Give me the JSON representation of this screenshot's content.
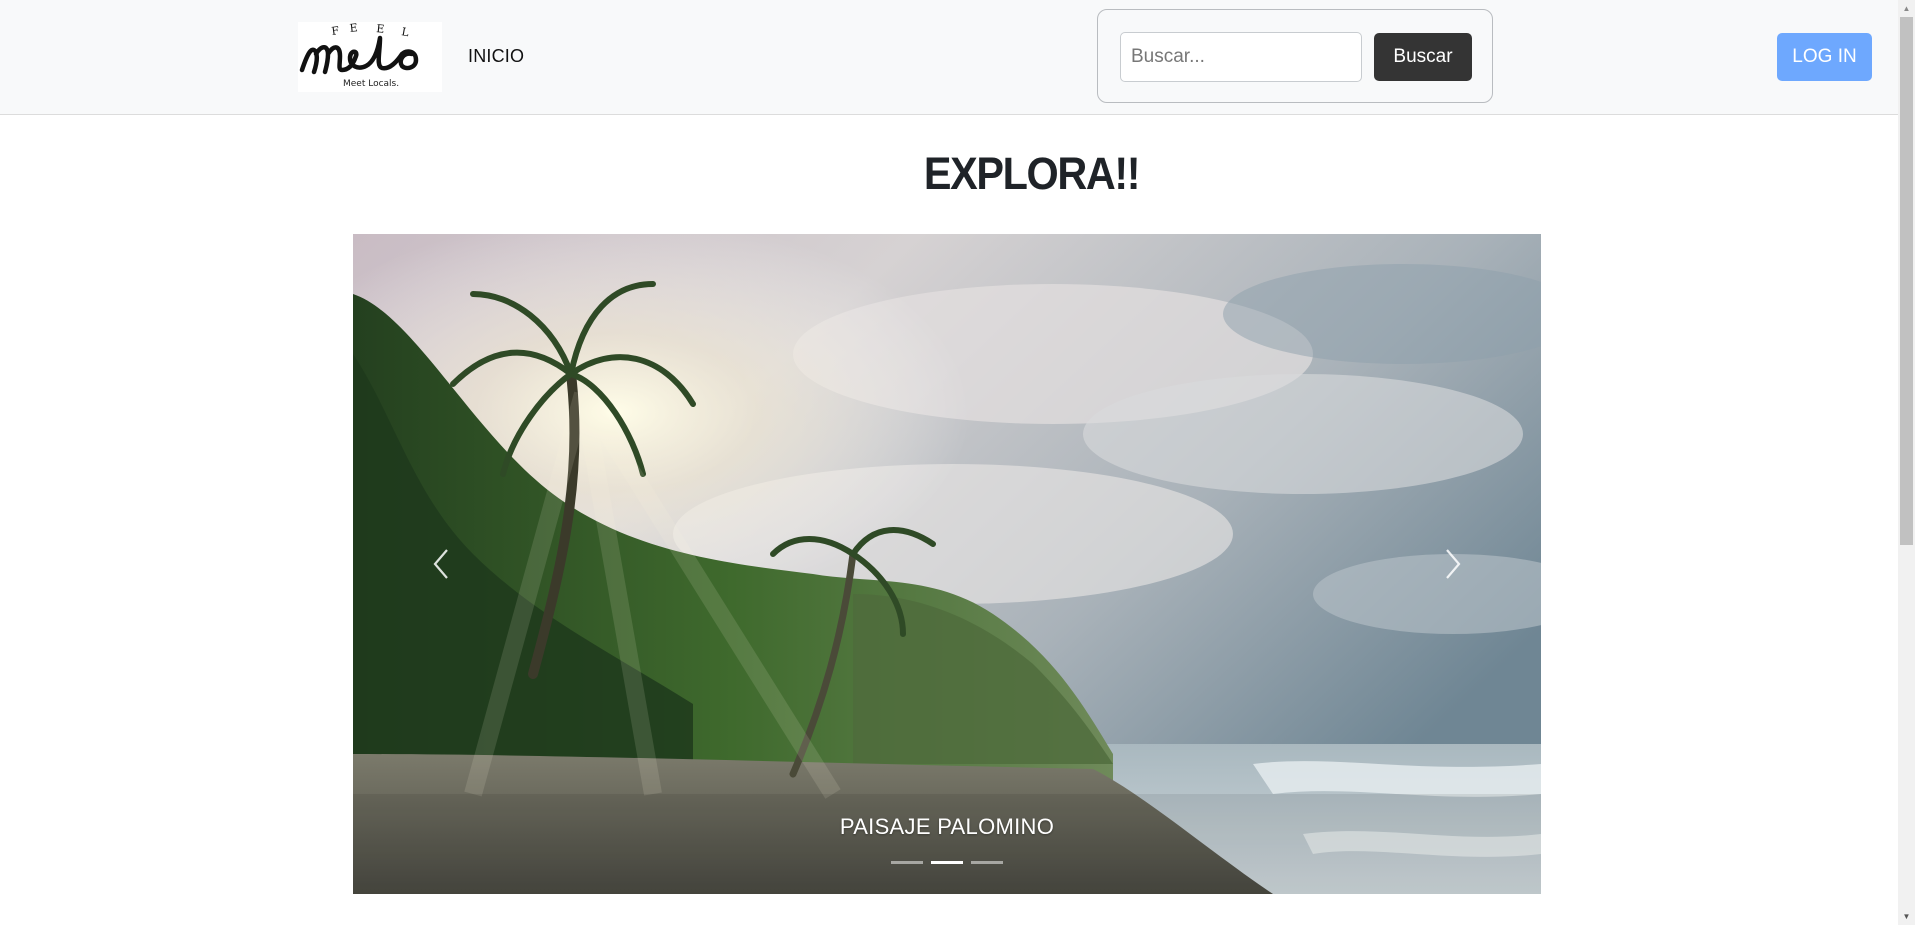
{
  "navbar": {
    "logo": {
      "top_text": "FEEL",
      "main_text": "Melo",
      "tagline": "Meet Locals."
    },
    "links": [
      {
        "label": "INICIO"
      }
    ],
    "search": {
      "placeholder": "Buscar...",
      "value": "",
      "button_label": "Buscar"
    },
    "login_label": "LOG IN",
    "colors": {
      "background": "#f8f9fa",
      "search_button": "#343434",
      "login_button": "#6ea8fe"
    }
  },
  "main": {
    "title": "EXPLORA!!",
    "carousel": {
      "caption": "PAISAJE PALOMINO",
      "indicator_count": 3,
      "active_index": 1,
      "prev_icon": "chevron-left-icon",
      "next_icon": "chevron-right-icon"
    }
  }
}
